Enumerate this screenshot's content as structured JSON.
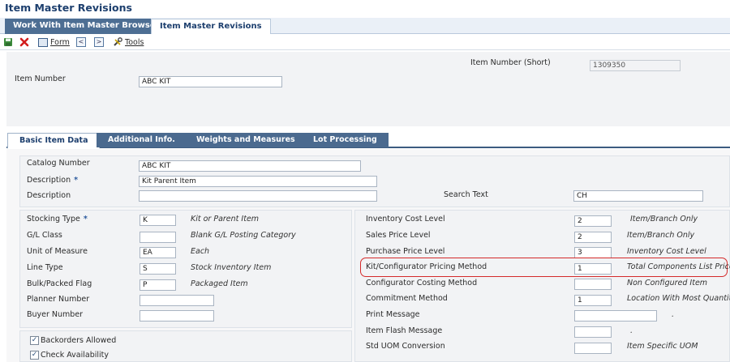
{
  "app": {
    "title": "Item Master Revisions"
  },
  "top_tabs": [
    {
      "label": "Work With Item Master Browse"
    },
    {
      "label": "Item Master Revisions"
    }
  ],
  "toolbar": {
    "form_label": "Form",
    "tools_label": "Tools",
    "prev": "<",
    "next": ">"
  },
  "header": {
    "item_number_short_label": "Item Number (Short)",
    "item_number_short_value": "1309350",
    "item_number_label": "Item Number",
    "item_number_value": "ABC KIT"
  },
  "form_tabs": [
    {
      "label": "Basic Item Data"
    },
    {
      "label": "Additional Info."
    },
    {
      "label": "Weights and Measures"
    },
    {
      "label": "Lot Processing"
    }
  ],
  "basic": {
    "catalog_number_label": "Catalog Number",
    "catalog_number_value": "ABC KIT",
    "description_label": "Description",
    "description_value": "Kit Parent Item",
    "description2_label": "Description",
    "description2_value": "",
    "search_text_label": "Search Text",
    "search_text_value": "CH",
    "required_marker": "*"
  },
  "left_fields": [
    {
      "label": "Stocking Type",
      "value": "K",
      "desc": "Kit or Parent Item"
    },
    {
      "label": "G/L Class",
      "value": "",
      "desc": "Blank G/L Posting Category"
    },
    {
      "label": "Unit of Measure",
      "value": "EA",
      "desc": "Each"
    },
    {
      "label": "Line Type",
      "value": "S",
      "desc": "Stock Inventory Item"
    },
    {
      "label": "Bulk/Packed Flag",
      "value": "P",
      "desc": "Packaged Item"
    },
    {
      "label": "Planner Number",
      "value": ""
    },
    {
      "label": "Buyer Number",
      "value": ""
    }
  ],
  "checkboxes": [
    {
      "label": "Backorders Allowed",
      "checked": true
    },
    {
      "label": "Check Availability",
      "checked": true
    }
  ],
  "check_mark": "✓",
  "right_fields": [
    {
      "label": "Inventory Cost Level",
      "value": "2",
      "desc": "Item/Branch Only"
    },
    {
      "label": "Sales Price Level",
      "value": "2",
      "desc": "Item/Branch Only"
    },
    {
      "label": "Purchase Price Level",
      "value": "3",
      "desc": "Inventory Cost Level"
    },
    {
      "label": "Kit/Configurator Pricing Method",
      "value": "1",
      "desc": "Total Components List Prices"
    },
    {
      "label": "Configurator Costing Method",
      "value": "",
      "desc": "Non Configured Item"
    },
    {
      "label": "Commitment Method",
      "value": "1",
      "desc": "Location With Most Quantity"
    },
    {
      "label": "Print Message",
      "value": "",
      "desc": "."
    },
    {
      "label": "Item Flash Message",
      "value": "",
      "desc": "."
    },
    {
      "label": "Std UOM Conversion",
      "value": "",
      "desc": "Item Specific UOM"
    }
  ],
  "colors": {
    "accent": "#1d3f6e",
    "tab_inactive": "#4b6a8f",
    "highlight": "#d42a2a"
  }
}
